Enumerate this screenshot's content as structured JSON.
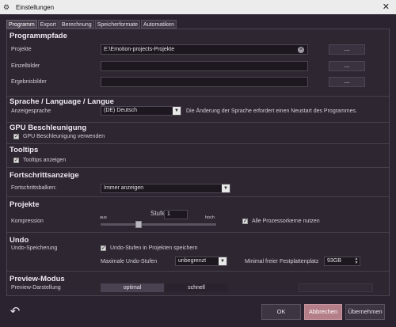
{
  "window": {
    "title": "Einstellungen"
  },
  "tabs": [
    "Programm",
    "Export",
    "Berechnung",
    "Speicherformate",
    "Automatiken"
  ],
  "sections": {
    "paths": {
      "title": "Programmpfade",
      "projects_label": "Projekte",
      "projects_value": "E:\\Emotion-projects-Projekte",
      "single_label": "Einzelbilder",
      "single_value": "",
      "results_label": "Ergebnisbilder",
      "results_value": "",
      "browse_label": "..."
    },
    "language": {
      "title": "Sprache / Language / Langue",
      "label": "Anzeigesprache",
      "value": "(DE) Deutsch",
      "note": "Die Änderung der Sprache erfordert einen Neustart des Programmes."
    },
    "gpu": {
      "title": "GPU Beschleunigung",
      "checkbox": "GPU Beschleunigung verwenden",
      "checked": true
    },
    "tooltips": {
      "title": "Tooltips",
      "checkbox": "Tooltips anzeigen",
      "checked": true
    },
    "progress": {
      "title": "Fortschrittsanzeige",
      "label": "Fortschrittsbalken:",
      "value": "Immer anzeigen"
    },
    "projects": {
      "title": "Projekte",
      "compression_label": "Kompression",
      "low_label": "aus",
      "high_label": "hoch",
      "level_label": "Stufe",
      "level_value": "1",
      "slider_fraction": 0.33,
      "all_cores_label": "Alle Prozessorkerne nutzen",
      "all_cores_checked": true
    },
    "undo": {
      "title": "Undo",
      "label": "Undo-Speicherung",
      "checkbox": "Undo-Stufen in Projekten speichern",
      "checked": true,
      "max_label": "Maximale Undo-Stufen",
      "max_value": "unbegrenzt",
      "min_free_label": "Minimal freier Festplattenplatz",
      "min_free_value": "93GB"
    },
    "preview": {
      "title": "Preview-Modus",
      "label": "Preview-Darstellung",
      "option_optimal": "optimal",
      "option_fast": "schnell",
      "selected": "optimal"
    }
  },
  "footer": {
    "ok": "OK",
    "cancel": "Abbrechen",
    "apply": "Übernehmen"
  },
  "colors": {
    "accent": "#b57f8a",
    "background": "#2b2430",
    "field": "#1d181f"
  },
  "icons": {
    "app": "settings-app-icon",
    "close": "close-icon",
    "clear": "clear-icon",
    "undo": "undo-arrow-icon"
  }
}
